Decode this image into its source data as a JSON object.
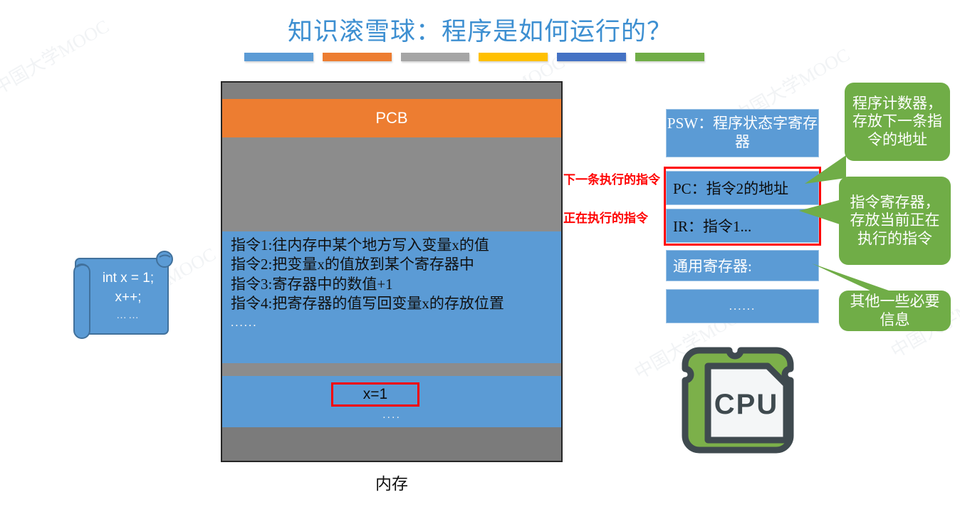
{
  "title": "知识滚雪球：程序是如何运行的？",
  "rule_colors": [
    "#5B9BD5",
    "#ED7D31",
    "#A5A5A5",
    "#FFC000",
    "#4472C4",
    "#70AD47"
  ],
  "accent": {
    "title_blue": "#3D8FD1",
    "memory_blue": "#5B9BD5",
    "memory_gray": "#8C8C8C",
    "pcb_orange": "#ED7D31",
    "callout_green": "#70AD47",
    "highlight_red": "#FF0000"
  },
  "memory": {
    "label": "内存",
    "pcb_label": "PCB",
    "instructions": [
      "指令1:往内存中某个地方写入变量x的值",
      "指令2:把变量x的值放到某个寄存器中",
      "指令3:寄存器中的数值+1",
      "指令4:把寄存器的值写回变量x的存放位置"
    ],
    "instructions_more": "......",
    "data_value": "x=1",
    "data_more": "...."
  },
  "annotations": {
    "next_instruction": "下一条执行的指令",
    "current_instruction": "正在执行的指令"
  },
  "registers": [
    {
      "id": "psw",
      "label": "PSW：程序状态字寄存器"
    },
    {
      "id": "pc",
      "label": "PC：指令2的地址"
    },
    {
      "id": "ir",
      "label": "IR：指令1..."
    },
    {
      "id": "gp",
      "label": "通用寄存器:"
    },
    {
      "id": "etc",
      "label": "......"
    }
  ],
  "callouts": [
    {
      "id": "pc",
      "text": "程序计数器，存放下一条指令的地址"
    },
    {
      "id": "ir",
      "text": "指令寄存器，存放当前正在执行的指令"
    },
    {
      "id": "etc",
      "text": "其他一些必要信息"
    }
  ],
  "code_scroll": {
    "line1": "int x = 1;",
    "line2": "x++;",
    "line3": "……"
  },
  "cpu": {
    "label": "CPU"
  },
  "watermarks": [
    "中国大学MOOC",
    "中国大学MOOC",
    "中国大学MOOC",
    "中国大学MOOC",
    "中国大学MOOC",
    "中国大学MOOC"
  ]
}
